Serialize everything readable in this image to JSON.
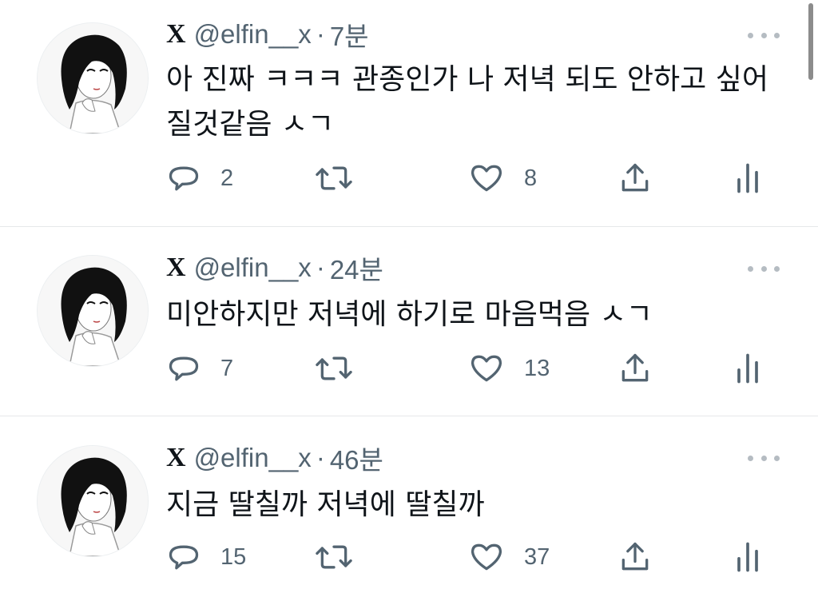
{
  "feed": {
    "tweets": [
      {
        "display_name": "X",
        "handle": "@elfin__x",
        "separator": "·",
        "time": "7분",
        "text": "아 진짜 ㅋㅋㅋ 관종인가 나 저녁 되도 안하고 싶어질것같음 ㅅㄱ",
        "replies": "2",
        "retweets": "",
        "likes": "8"
      },
      {
        "display_name": "X",
        "handle": "@elfin__x",
        "separator": "·",
        "time": "24분",
        "text": "미안하지만 저녁에 하기로 마음먹음 ㅅㄱ",
        "replies": "7",
        "retweets": "",
        "likes": "13"
      },
      {
        "display_name": "X",
        "handle": "@elfin__x",
        "separator": "·",
        "time": "46분",
        "text": "지금 딸칠까 저녁에 딸칠까",
        "replies": "15",
        "retweets": "",
        "likes": "37"
      }
    ]
  },
  "colors": {
    "text_primary": "#0f1419",
    "text_secondary": "#536471",
    "divider": "#e6e8ea",
    "icon": "#536471"
  },
  "icons": [
    "more-icon",
    "reply-icon",
    "retweet-icon",
    "like-icon",
    "share-icon",
    "views-icon"
  ]
}
